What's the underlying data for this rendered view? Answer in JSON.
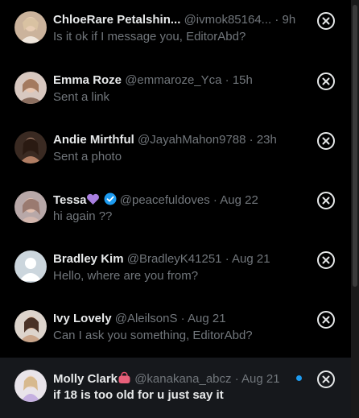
{
  "messages": [
    {
      "name": "ChloeRare Petalshin...",
      "handle": "@ivmok85164...",
      "dot": "·",
      "time": "9h",
      "preview": "Is it ok if I message you, EditorAbd?"
    },
    {
      "name": "Emma Roze",
      "handle": "@emmaroze_Yca",
      "dot": "·",
      "time": "15h",
      "preview": "Sent a link"
    },
    {
      "name": "Andie Mirthful",
      "handle": "@JayahMahon9788",
      "dot": "·",
      "time": "23h",
      "preview": "Sent a photo"
    },
    {
      "name": "Tessa",
      "handle": "@peacefuldoves",
      "dot": "·",
      "time": "Aug 22",
      "preview": "hi again ??"
    },
    {
      "name": "Bradley Kim",
      "handle": "@BradleyK41251",
      "dot": "·",
      "time": "Aug 21",
      "preview": "Hello, where are you from?"
    },
    {
      "name": "Ivy Lovely",
      "handle": "@AleilsonS",
      "dot": "·",
      "time": "Aug 21",
      "preview": "Can I ask you something, EditorAbd?"
    },
    {
      "name": "Molly Clark",
      "handle": "@kanakana_abcz",
      "dot": "·",
      "time": "Aug 21",
      "preview": "if 18 is too old for u just say it"
    }
  ],
  "icons": {
    "close": "close-circle-icon",
    "verified": "verified-badge-icon",
    "heart": "purple-heart-icon",
    "bag": "pink-handbag-icon"
  },
  "colors": {
    "background": "#000000",
    "highlight_row": "#16181c",
    "primary_text": "#e7e9ea",
    "secondary_text": "#71767b",
    "accent_blue": "#1d9bf0"
  }
}
